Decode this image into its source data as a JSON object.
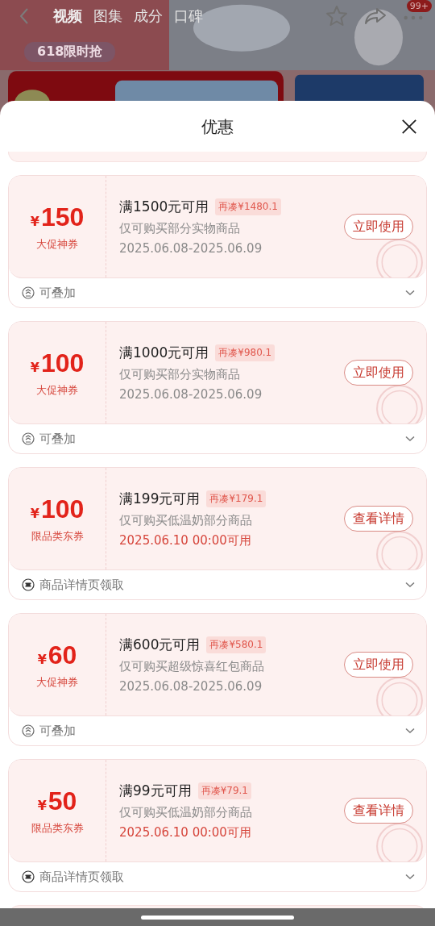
{
  "background_page": {
    "tabs": [
      {
        "label": "视频",
        "selected": true
      },
      {
        "label": "图集",
        "selected": false
      },
      {
        "label": "成分",
        "selected": false
      },
      {
        "label": "口碑",
        "selected": false
      }
    ],
    "badge": "99+",
    "promo_pill": "618限时抢"
  },
  "sheet": {
    "title": "优惠"
  },
  "coupons": [
    {
      "currency": "¥",
      "amount": "150",
      "type": "大促神券",
      "threshold": "满1500元可用",
      "gap": "再凑¥1480.1",
      "scope": "仅可购买部分实物商品",
      "date": "2025.06.08-2025.06.09",
      "date_upcoming": false,
      "action": "立即使用",
      "kind": "stack",
      "footer": "可叠加"
    },
    {
      "currency": "¥",
      "amount": "100",
      "type": "大促神券",
      "threshold": "满1000元可用",
      "gap": "再凑¥980.1",
      "scope": "仅可购买部分实物商品",
      "date": "2025.06.08-2025.06.09",
      "date_upcoming": false,
      "action": "立即使用",
      "kind": "stack",
      "footer": "可叠加"
    },
    {
      "currency": "¥",
      "amount": "100",
      "type": "限品类东券",
      "threshold": "满199元可用",
      "gap": "再凑¥179.1",
      "scope": "仅可购买低温奶部分商品",
      "date": "2025.06.10 00:00可用",
      "date_upcoming": true,
      "action": "查看详情",
      "kind": "ticket",
      "footer": "商品详情页领取"
    },
    {
      "currency": "¥",
      "amount": "60",
      "type": "大促神券",
      "threshold": "满600元可用",
      "gap": "再凑¥580.1",
      "scope": "仅可购买超级惊喜红包商品",
      "date": "2025.06.08-2025.06.09",
      "date_upcoming": false,
      "action": "立即使用",
      "kind": "stack",
      "footer": "可叠加"
    },
    {
      "currency": "¥",
      "amount": "50",
      "type": "限品类东券",
      "threshold": "满99元可用",
      "gap": "再凑¥79.1",
      "scope": "仅可购买低温奶部分商品",
      "date": "2025.06.10 00:00可用",
      "date_upcoming": true,
      "action": "查看详情",
      "kind": "ticket",
      "footer": "商品详情页领取"
    }
  ]
}
